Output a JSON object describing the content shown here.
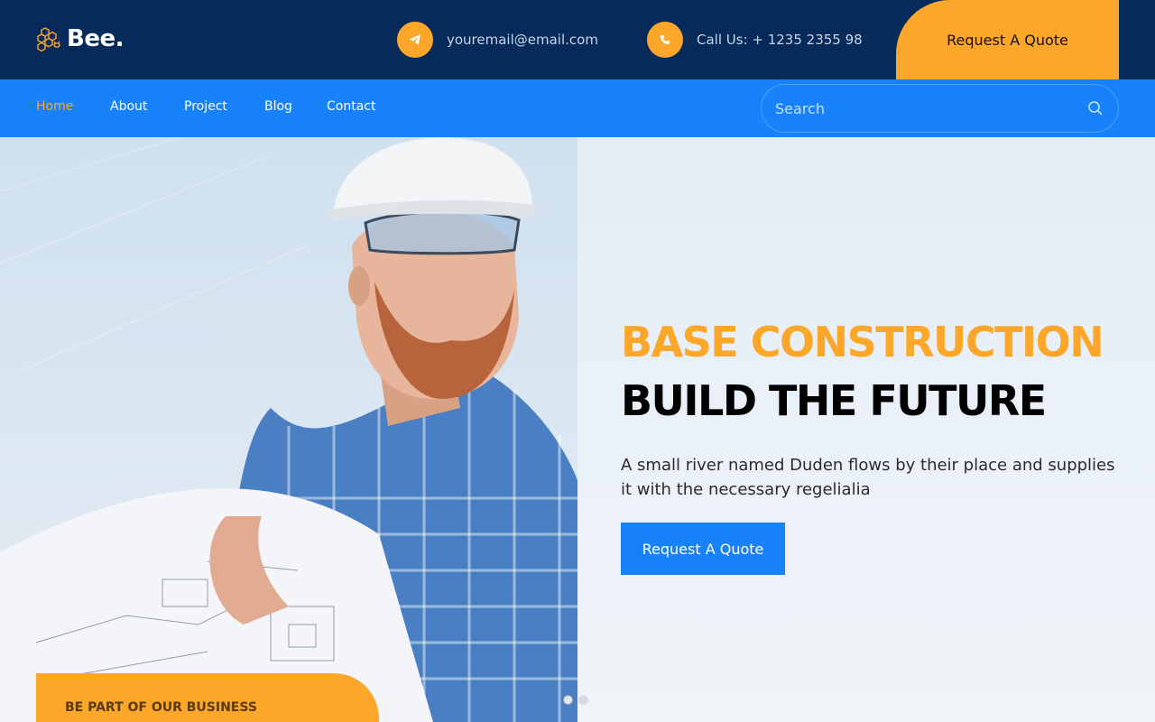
{
  "brand": {
    "name": "Bee."
  },
  "contact": {
    "email": "youremail@email.com",
    "phone": "Call Us: + 1235 2355 98"
  },
  "header": {
    "quote_label": "Request A Quote"
  },
  "nav": {
    "items": [
      {
        "label": "Home",
        "active": true
      },
      {
        "label": "About",
        "active": false
      },
      {
        "label": "Project",
        "active": false
      },
      {
        "label": "Blog",
        "active": false
      },
      {
        "label": "Contact",
        "active": false
      }
    ],
    "search_placeholder": "Search"
  },
  "hero": {
    "title_line1": "BASE CONSTRUCTION",
    "title_line2": "BUILD THE FUTURE",
    "description": "A small river named Duden flows by their place and supplies it with the necessary regelialia",
    "cta_label": "Request A Quote",
    "slide_count": 2,
    "active_slide": 1
  },
  "banner": {
    "label": "BE PART OF OUR BUSINESS"
  },
  "colors": {
    "navy": "#062b5b",
    "blue": "#1882fa",
    "orange": "#fda72a"
  },
  "icons": {
    "email": "telegram-plane-icon",
    "phone": "phone-icon",
    "search": "search-icon",
    "logo": "honeycomb-bee-icon"
  }
}
